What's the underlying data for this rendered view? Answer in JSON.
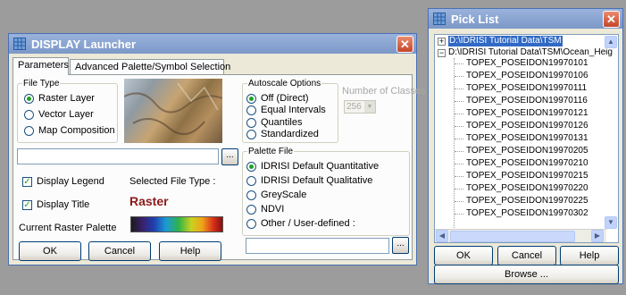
{
  "launcher": {
    "title": "DISPLAY Launcher",
    "tabs": [
      "Parameters",
      "Advanced Palette/Symbol Selection"
    ],
    "file_type": {
      "legend": "File Type",
      "options": [
        "Raster Layer",
        "Vector Layer",
        "Map Composition"
      ],
      "selected": "Raster Layer"
    },
    "file_input": {
      "value": ""
    },
    "browse_label": "...",
    "display_legend": {
      "label": "Display Legend",
      "checked": true
    },
    "display_title": {
      "label": "Display Title",
      "checked": true
    },
    "selected_file_type_label": "Selected File Type :",
    "selected_file_type_value": "Raster",
    "current_palette_label": "Current Raster Palette",
    "autoscale": {
      "legend": "Autoscale Options",
      "options": [
        "Off (Direct)",
        "Equal Intervals",
        "Quantiles",
        "Standardized"
      ],
      "selected": "Off (Direct)"
    },
    "num_classes": {
      "label": "Number of Classes",
      "value": "256"
    },
    "palette": {
      "legend": "Palette File",
      "options": [
        "IDRISI Default Quantitative",
        "IDRISI Default Qualitative",
        "GreyScale",
        "NDVI",
        "Other / User-defined :"
      ],
      "selected": "IDRISI Default Quantitative"
    },
    "palette_input": {
      "value": ""
    },
    "buttons": {
      "ok": "OK",
      "cancel": "Cancel",
      "help": "Help"
    }
  },
  "picklist": {
    "title": "Pick List",
    "root_collapsed": "D:\\IDRISI Tutorial Data\\TSM",
    "root_expanded": "D:\\IDRISI Tutorial Data\\TSM\\Ocean_Heig",
    "files": [
      "TOPEX_POSEIDON19970101",
      "TOPEX_POSEIDON19970106",
      "TOPEX_POSEIDON19970111",
      "TOPEX_POSEIDON19970116",
      "TOPEX_POSEIDON19970121",
      "TOPEX_POSEIDON19970126",
      "TOPEX_POSEIDON19970131",
      "TOPEX_POSEIDON19970205",
      "TOPEX_POSEIDON19970210",
      "TOPEX_POSEIDON19970215",
      "TOPEX_POSEIDON19970220",
      "TOPEX_POSEIDON19970225",
      "TOPEX_POSEIDON19970302"
    ],
    "buttons": {
      "ok": "OK",
      "cancel": "Cancel",
      "help": "Help",
      "browse": "Browse ..."
    }
  },
  "colors": {
    "selection": "#316ac5",
    "raster_text": "#8b1a1a"
  }
}
